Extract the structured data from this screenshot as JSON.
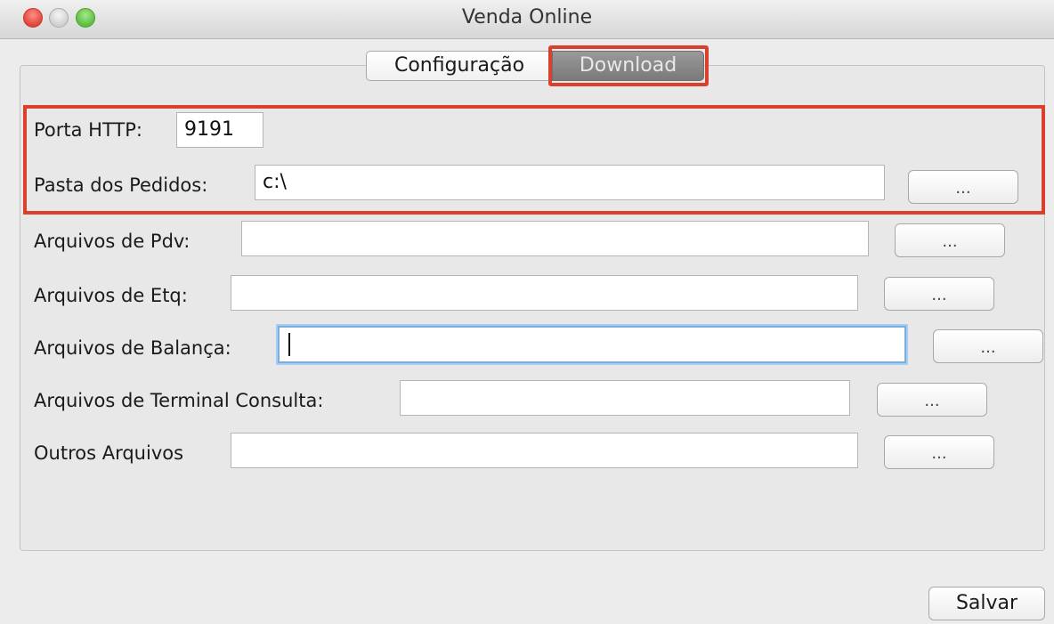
{
  "window": {
    "title": "Venda Online"
  },
  "tabs": {
    "config": "Configuração",
    "download": "Download"
  },
  "fields": {
    "porta_http": {
      "label": "Porta HTTP:",
      "value": "9191"
    },
    "pasta_pedidos": {
      "label": "Pasta dos Pedidos:",
      "value": "c:\\",
      "browse": "..."
    },
    "arquivos_pdv": {
      "label": "Arquivos de Pdv:",
      "value": "",
      "browse": "..."
    },
    "arquivos_etq": {
      "label": "Arquivos de Etq:",
      "value": "",
      "browse": "..."
    },
    "arquivos_balanca": {
      "label": "Arquivos de Balança:",
      "value": "",
      "browse": "..."
    },
    "arquivos_terminal": {
      "label": "Arquivos de Terminal Consulta:",
      "value": "",
      "browse": "..."
    },
    "outros_arquivos": {
      "label": "Outros Arquivos",
      "value": "",
      "browse": "..."
    }
  },
  "buttons": {
    "save": "Salvar"
  },
  "colors": {
    "highlight": "#d9412e",
    "focus": "#7aaede"
  }
}
